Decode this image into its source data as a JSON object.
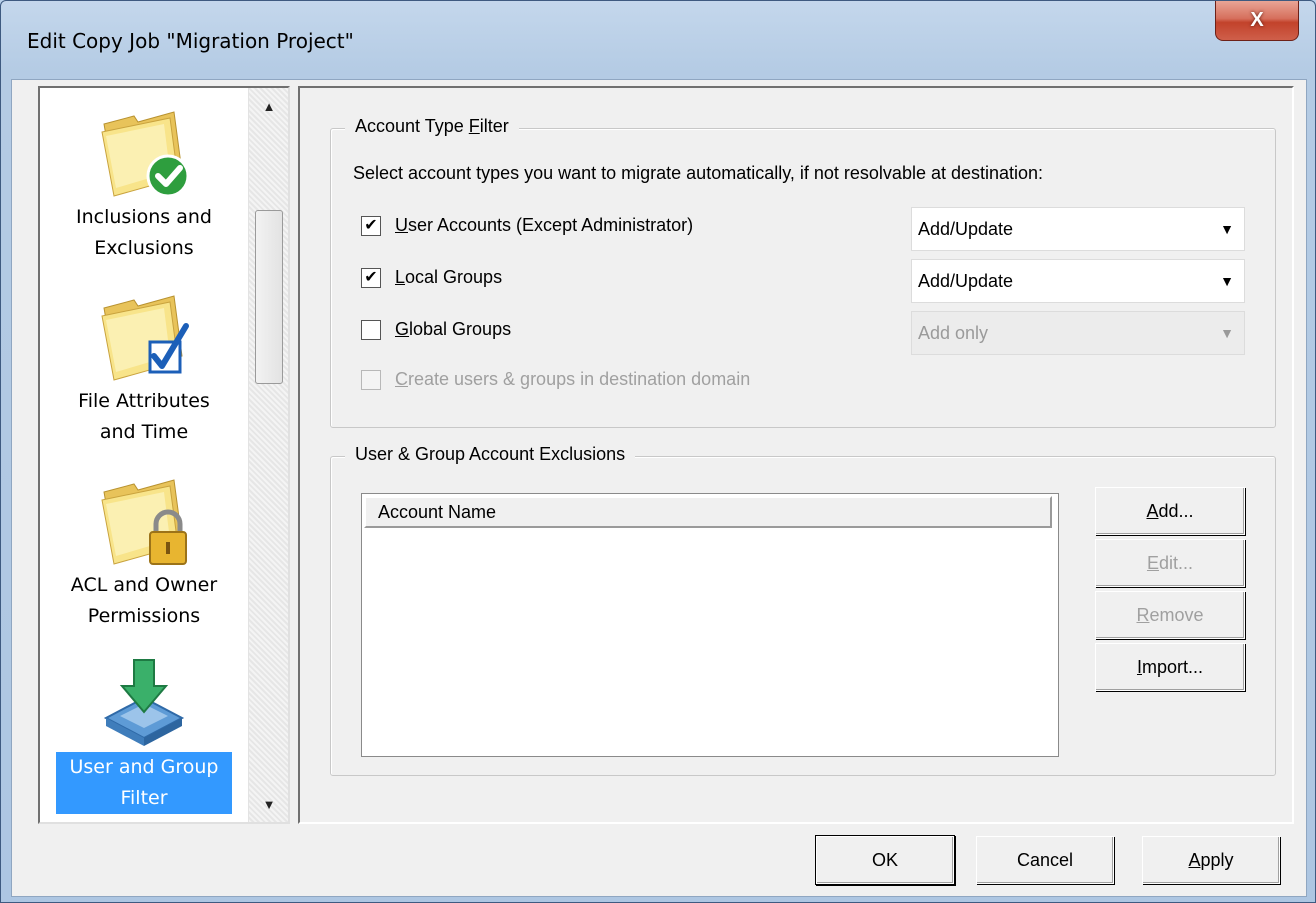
{
  "window": {
    "title": "Edit Copy Job \"Migration Project\"",
    "close_label": "X"
  },
  "nav": {
    "items": [
      {
        "label": "Inclusions and\nExclusions",
        "icon": "folder-check-icon",
        "selected": false
      },
      {
        "label": "File Attributes\nand Time",
        "icon": "folder-checkbox-icon",
        "selected": false
      },
      {
        "label": "ACL and Owner\nPermissions",
        "icon": "folder-lock-icon",
        "selected": false
      },
      {
        "label": "User and Group\nFilter",
        "icon": "download-tray-icon",
        "selected": true
      }
    ],
    "scroll_up": "▲",
    "scroll_down": "▼"
  },
  "account_filter": {
    "legend_pre": "Account Type ",
    "legend_u": "F",
    "legend_post": "ilter",
    "description": "Select account types you want to migrate automatically, if not resolvable at destination:",
    "rows": [
      {
        "u": "U",
        "rest": "ser Accounts (Except Administrator)",
        "checked": true,
        "value": "Add/Update",
        "enabled": true
      },
      {
        "u": "L",
        "rest": "ocal Groups",
        "checked": true,
        "value": "Add/Update",
        "enabled": true
      },
      {
        "u": "G",
        "rest": "lobal Groups",
        "checked": false,
        "value": "Add only",
        "enabled": false
      }
    ],
    "create": {
      "u": "C",
      "rest": "reate users & groups in destination domain",
      "checked": false,
      "enabled": false
    }
  },
  "exclusions": {
    "legend": "User & Group Account Exclusions",
    "column_header": "Account Name",
    "buttons": [
      {
        "u": "A",
        "rest": "dd...",
        "enabled": true
      },
      {
        "u": "E",
        "rest": "dit...",
        "enabled": false
      },
      {
        "u": "R",
        "rest": "emove",
        "enabled": false
      },
      {
        "u": "I",
        "rest": "mport...",
        "enabled": true
      }
    ]
  },
  "footer": {
    "ok": "OK",
    "cancel": "Cancel",
    "apply_u": "A",
    "apply_rest": "pply"
  },
  "colors": {
    "selection": "#3399ff",
    "folder": "#f5d66b",
    "check_green": "#2e9e3e"
  }
}
